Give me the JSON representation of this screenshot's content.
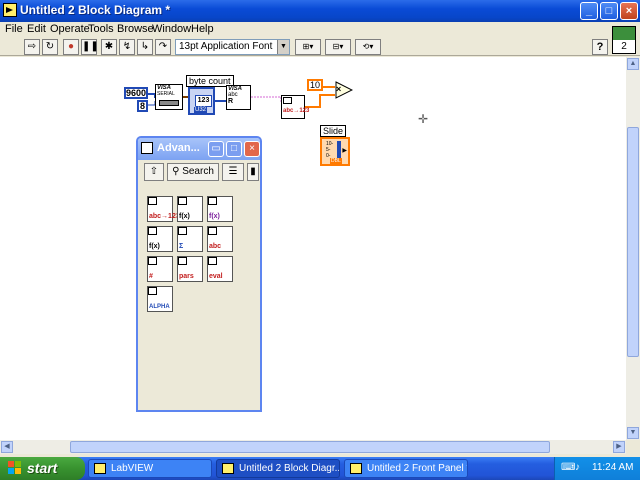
{
  "window": {
    "title": "Untitled 2 Block Diagram *",
    "controls": {
      "minimize": "_",
      "maximize": "□",
      "close": "×"
    }
  },
  "menubar": {
    "items": [
      {
        "label": "File"
      },
      {
        "label": "Edit"
      },
      {
        "label": "Operate"
      },
      {
        "label": "Tools"
      },
      {
        "label": "Browse"
      },
      {
        "label": "Window"
      },
      {
        "label": "Help"
      }
    ]
  },
  "toolbar": {
    "buttons": [
      {
        "name": "run-arrow-icon",
        "glyph": "⇨"
      },
      {
        "name": "run-continuously-icon",
        "glyph": "↻"
      },
      {
        "name": "abort-icon",
        "glyph": "●"
      },
      {
        "name": "pause-icon",
        "glyph": "❚❚"
      },
      {
        "name": "highlight-execution-icon",
        "glyph": "✱"
      },
      {
        "name": "retain-wire-values-icon",
        "glyph": "↯"
      },
      {
        "name": "step-into-icon",
        "glyph": "↳"
      },
      {
        "name": "step-over-icon",
        "glyph": "↷"
      },
      {
        "name": "step-out-icon",
        "glyph": "↰"
      }
    ],
    "font_select": "13pt Application Font",
    "help_glyph": "?",
    "connector_number": "2"
  },
  "diagram": {
    "baud_const": "9600",
    "small_const": "8",
    "visa_label": "VISA",
    "serial_label": "SERIAL",
    "byte_count_label": "byte count",
    "byte_count_value": "123",
    "byte_count_type": "U32",
    "visa_read_label": "VISA",
    "visa_read_abc": "abc",
    "visa_read_r": "R",
    "convert_label": "abc→123",
    "ten_const": "10",
    "multiply_glyph": "×",
    "slide_label": "Slide",
    "slide_ticks": [
      "10-",
      "5-",
      "0-"
    ],
    "slide_type": "DBL"
  },
  "palette": {
    "title": "Advan...",
    "search_label": "Search",
    "up_glyph": "⇧",
    "items": [
      {
        "name": "string-number-conversion-icon",
        "text": "abc→123"
      },
      {
        "name": "formula-icon",
        "text": "f(x)"
      },
      {
        "name": "graph-function-icon",
        "text": "f(x)"
      },
      {
        "name": "path-function-icon",
        "text": "f(x)"
      },
      {
        "name": "scientific-function-icon",
        "text": "Σ"
      },
      {
        "name": "string-array-icon",
        "text": "abc"
      },
      {
        "name": "array-numeric-icon",
        "text": "#"
      },
      {
        "name": "parse-icon",
        "text": "pars"
      },
      {
        "name": "eval-icon",
        "text": "eval"
      },
      {
        "name": "alpha-icon",
        "text": "ALPHA"
      }
    ]
  },
  "taskbar": {
    "start_label": "start",
    "tasks": [
      {
        "label": "LabVIEW",
        "active": false
      },
      {
        "label": "Untitled 2 Block Diagr...",
        "active": true
      },
      {
        "label": "Untitled 2 Front Panel *",
        "active": false
      }
    ],
    "clock": "11:24 AM"
  },
  "colors": {
    "titlebar_blue": "#0a4bd6",
    "integer_blue": "#2049b5",
    "double_orange": "#ff7a00",
    "string_pink": "#d66ad6"
  }
}
